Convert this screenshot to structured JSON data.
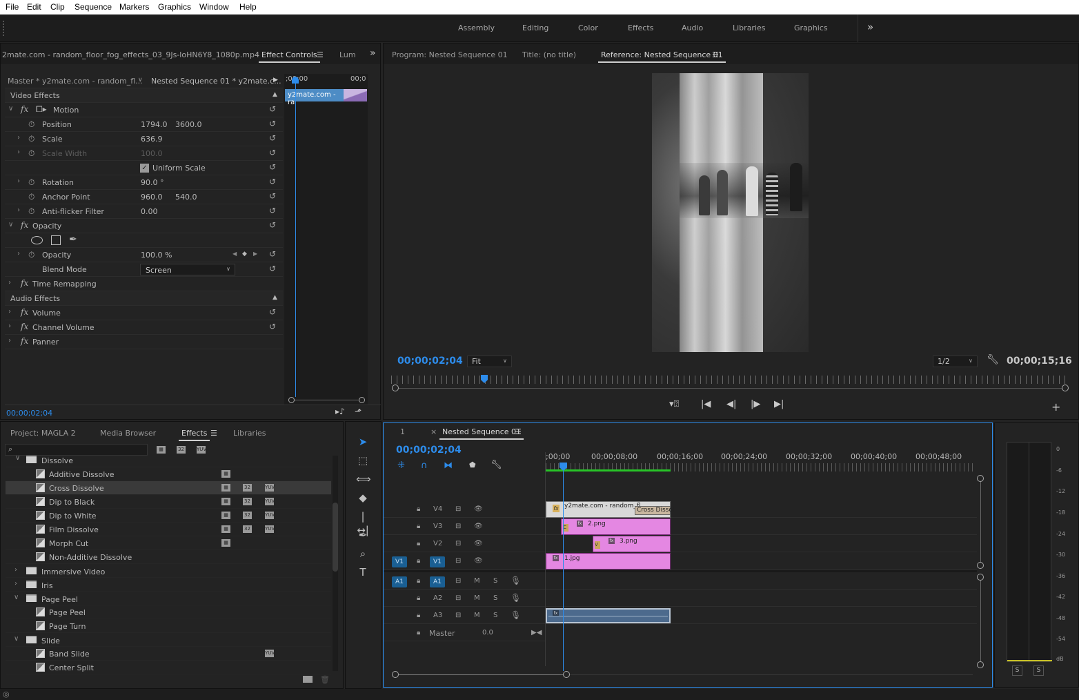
{
  "menu": [
    "File",
    "Edit",
    "Clip",
    "Sequence",
    "Markers",
    "Graphics",
    "Window",
    "Help"
  ],
  "workspaces": [
    "Assembly",
    "Editing",
    "Color",
    "Effects",
    "Audio",
    "Libraries",
    "Graphics"
  ],
  "workspaces_more": "»",
  "source_panel": {
    "clip_name": "2mate.com - random_floor_fog_effects_03_9Js-loHN6Y8_1080p.mp4",
    "tab_effect_controls": "Effect Controls",
    "tab_lumetri": "Lum",
    "master_label": "Master * y2mate.com - random_fl...",
    "sequence_label": "Nested Sequence 01 * y2mate.c...",
    "mini_time_start": ";00;00",
    "mini_time_end": "00;0",
    "mini_clip_label": "y2mate.com - ra",
    "video_effects": "Video Effects",
    "motion": "Motion",
    "position": {
      "label": "Position",
      "x": "1794.0",
      "y": "3600.0"
    },
    "scale": {
      "label": "Scale",
      "value": "636.9"
    },
    "scale_width": {
      "label": "Scale Width",
      "value": "100.0"
    },
    "uniform_scale": "Uniform Scale",
    "rotation": {
      "label": "Rotation",
      "value": "90.0 °"
    },
    "anchor_point": {
      "label": "Anchor Point",
      "x": "960.0",
      "y": "540.0"
    },
    "anti_flicker": {
      "label": "Anti-flicker Filter",
      "value": "0.00"
    },
    "opacity_group": "Opacity",
    "opacity": {
      "label": "Opacity",
      "value": "100.0 %"
    },
    "blend_mode": {
      "label": "Blend Mode",
      "value": "Screen"
    },
    "time_remapping": "Time Remapping",
    "audio_effects": "Audio Effects",
    "volume": "Volume",
    "channel_volume": "Channel Volume",
    "panner": "Panner",
    "timecode": "00;00;02;04"
  },
  "program": {
    "tab_program": "Program: Nested Sequence 01",
    "tab_title": "Title: (no title)",
    "tab_reference": "Reference: Nested Sequence 01",
    "timecode": "00;00;02;04",
    "fit": "Fit",
    "resolution": "1/2",
    "duration": "00;00;15;16"
  },
  "project": {
    "tab_project": "Project: MAGLA 2",
    "tab_media_browser": "Media Browser",
    "tab_effects": "Effects",
    "tab_libraries": "Libraries",
    "search_placeholder": "",
    "items": [
      {
        "label": "Dissolve",
        "type": "folder",
        "open": true
      },
      {
        "label": "Additive Dissolve",
        "type": "effect"
      },
      {
        "label": "Cross Dissolve",
        "type": "effect",
        "selected": true
      },
      {
        "label": "Dip to Black",
        "type": "effect"
      },
      {
        "label": "Dip to White",
        "type": "effect"
      },
      {
        "label": "Film Dissolve",
        "type": "effect"
      },
      {
        "label": "Morph Cut",
        "type": "effect"
      },
      {
        "label": "Non-Additive Dissolve",
        "type": "effect"
      },
      {
        "label": "Immersive Video",
        "type": "folder"
      },
      {
        "label": "Iris",
        "type": "folder"
      },
      {
        "label": "Page Peel",
        "type": "folder",
        "open": true
      },
      {
        "label": "Page Peel",
        "type": "effect"
      },
      {
        "label": "Page Turn",
        "type": "effect"
      },
      {
        "label": "Slide",
        "type": "folder",
        "open": true
      },
      {
        "label": "Band Slide",
        "type": "effect"
      },
      {
        "label": "Center Split",
        "type": "effect"
      }
    ]
  },
  "timeline": {
    "tab_number": "1",
    "tab_sequence": "Nested Sequence 01",
    "timecode": "00;00;02;04",
    "ruler": [
      ";00;00",
      "00;00;08;00",
      "00;00;16;00",
      "00;00;24;00",
      "00;00;32;00",
      "00;00;40;00",
      "00;00;48;00"
    ],
    "tracks_video": [
      "V4",
      "V3",
      "V2",
      "V1"
    ],
    "tracks_audio": [
      "A1",
      "A2",
      "A3"
    ],
    "source_v1": "V1",
    "source_a1": "A1",
    "master_label": "Master",
    "master_value": "0.0",
    "m_label": "M",
    "s_label": "S",
    "clip_v4": "y2mate.com - random_fl",
    "clip_v4_transition": "Cross Dissol",
    "clip_v3": "2.png",
    "clip_v2": "3.png",
    "clip_v1": "1.jpg",
    "fx_label": "fx"
  },
  "meter": {
    "scale": [
      "0",
      "-6",
      "-12",
      "-18",
      "-24",
      "-30",
      "-36",
      "-42",
      "-48",
      "-54",
      "dB"
    ],
    "solo_left": "S",
    "solo_right": "S"
  },
  "colors": {
    "accent": "#2d8ceb",
    "pink": "#e487e2",
    "track_blue": "#1a5f93"
  }
}
